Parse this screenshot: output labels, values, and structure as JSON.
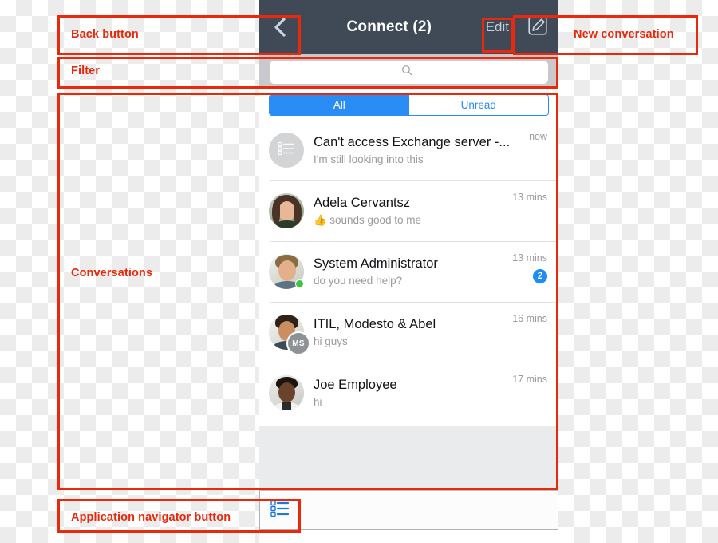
{
  "header": {
    "title": "Connect (2)",
    "back_icon": "chevron-left-icon",
    "edit_label": "Edit",
    "compose_icon": "compose-pencil-square-icon"
  },
  "filter": {
    "placeholder": "",
    "search_icon": "search-magnifier-icon"
  },
  "segments": [
    {
      "label": "All",
      "active": true
    },
    {
      "label": "Unread",
      "active": false
    }
  ],
  "conversations": [
    {
      "title": "Can't access Exchange server -...",
      "preview": "I'm still looking into this",
      "time": "now",
      "avatar_type": "list-icon",
      "online": false,
      "unread": "",
      "reaction": "",
      "group_initials": ""
    },
    {
      "title": "Adela Cervantsz",
      "preview": "sounds good to me",
      "time": "13 mins",
      "avatar_type": "photo-woman",
      "online": false,
      "unread": "",
      "reaction": "👍",
      "group_initials": ""
    },
    {
      "title": "System Administrator",
      "preview": "do you need help?",
      "time": "13 mins",
      "avatar_type": "photo-man-1",
      "online": true,
      "unread": "2",
      "reaction": "",
      "group_initials": ""
    },
    {
      "title": "ITIL, Modesto & Abel",
      "preview": "hi guys",
      "time": "16 mins",
      "avatar_type": "photo-man-2",
      "online": false,
      "unread": "",
      "reaction": "",
      "group_initials": "MS"
    },
    {
      "title": "Joe Employee",
      "preview": "hi",
      "time": "17 mins",
      "avatar_type": "photo-man-3",
      "online": false,
      "unread": "",
      "reaction": "",
      "group_initials": ""
    }
  ],
  "bottom_bar": {
    "app_nav_icon": "application-navigator-list-icon"
  },
  "annotations": {
    "back_button": "Back button",
    "new_conversation": "New conversation",
    "filter": "Filter",
    "conversations": "Conversations",
    "app_navigator": "Application navigator button",
    "color": "#e8290b"
  }
}
